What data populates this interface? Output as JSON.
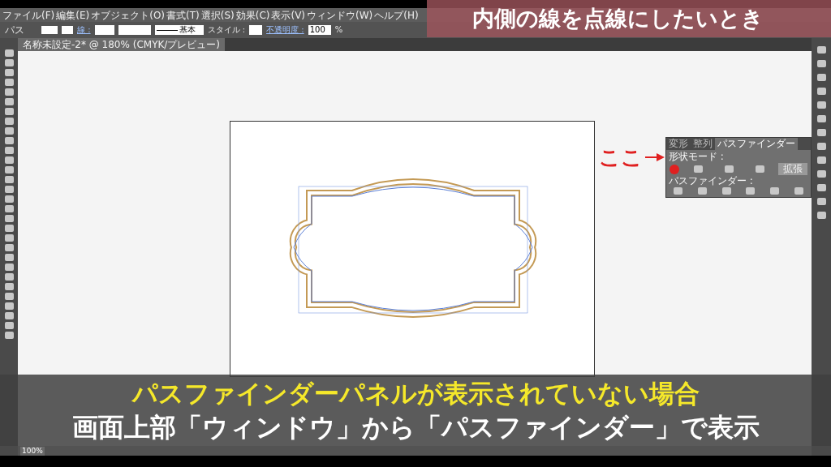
{
  "menu_bar": {
    "items": [
      "ファイル(F)",
      "編集(E)",
      "オブジェクト(O)",
      "書式(T)",
      "選択(S)",
      "効果(C)",
      "表示(V)",
      "ウィンドウ(W)",
      "ヘルプ(H)"
    ]
  },
  "control_bar": {
    "selection_label": "パス",
    "stroke_label": "線 :",
    "stroke_profile": "基本",
    "style_label": "スタイル :",
    "opacity_label": "不透明度 :",
    "opacity_value": "100",
    "opacity_unit": "%"
  },
  "document_tab": {
    "title": "名称未設定-2* @ 180% (CMYK/プレビュー)"
  },
  "pathfinder_panel": {
    "tabs": [
      {
        "label": "変形",
        "selected": false
      },
      {
        "label": "整列",
        "selected": false
      },
      {
        "label": "パスファインダー",
        "selected": true
      }
    ],
    "shape_modes_label": "形状モード :",
    "expand_button": "拡張",
    "pathfinders_label": "パスファインダー :"
  },
  "annotation": {
    "text": "ここ"
  },
  "status_bar": {
    "zoom": "100%"
  },
  "captions": {
    "title": "内側の線を点線にしたいとき",
    "lines": [
      "パスファインダーパネルが表示されていない場合",
      "画面上部「ウィンドウ」から「パスファインダー」で表示"
    ]
  }
}
